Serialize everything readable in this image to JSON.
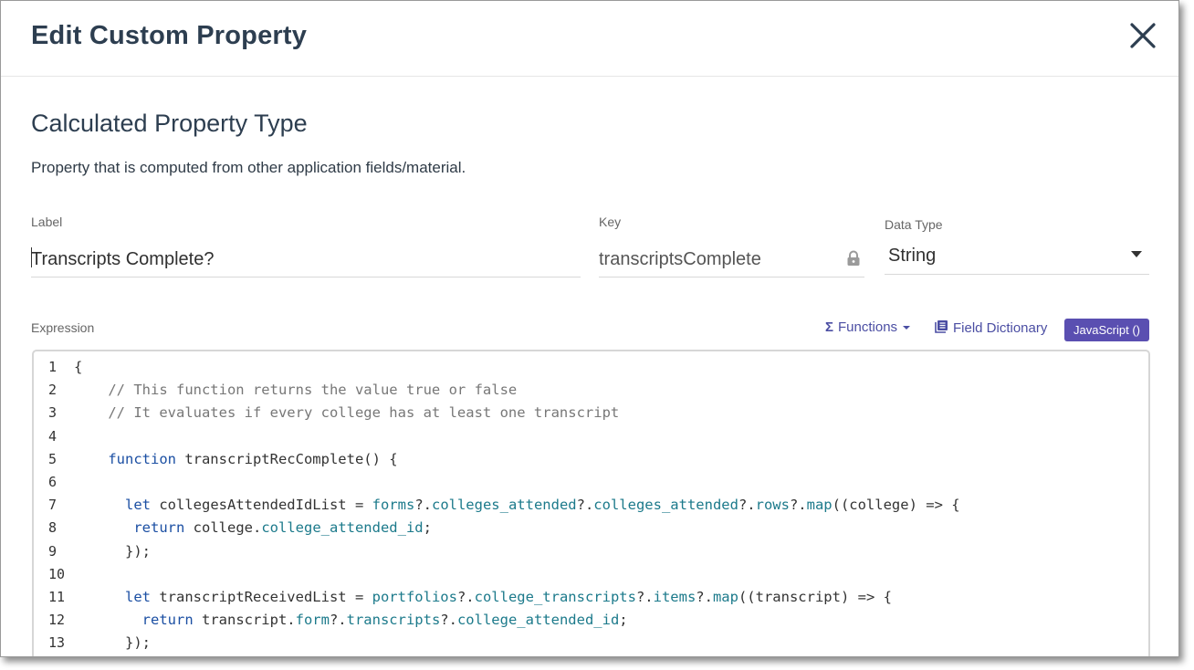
{
  "dialog": {
    "title": "Edit Custom Property",
    "section_title": "Calculated Property Type",
    "description": "Property that is computed from other application fields/material."
  },
  "fields": {
    "label": {
      "label": "Label",
      "value": "Transcripts Complete?"
    },
    "key": {
      "label": "Key",
      "value": "transcriptsComplete"
    },
    "data_type": {
      "label": "Data Type",
      "value": "String"
    }
  },
  "expression": {
    "label": "Expression",
    "functions_label": "Functions",
    "field_dictionary_label": "Field Dictionary",
    "language_button": "JavaScript ()"
  },
  "colors": {
    "accent": "#5a4fb1",
    "title": "#2d3e50",
    "keyword": "#1b4fa3",
    "property": "#1c7a8b",
    "comment": "#777777"
  },
  "code_lines": [
    {
      "n": "1",
      "tokens": [
        [
          "pl",
          "{"
        ]
      ]
    },
    {
      "n": "2",
      "tokens": [
        [
          "cm",
          "    // This function returns the value true or false"
        ]
      ]
    },
    {
      "n": "3",
      "tokens": [
        [
          "cm",
          "    // It evaluates if every college has at least one transcript"
        ]
      ]
    },
    {
      "n": "4",
      "tokens": []
    },
    {
      "n": "5",
      "tokens": [
        [
          "kw",
          "    function"
        ],
        [
          "pl",
          " transcriptRecComplete() {"
        ]
      ]
    },
    {
      "n": "6",
      "tokens": []
    },
    {
      "n": "7",
      "tokens": [
        [
          "kw",
          "      let"
        ],
        [
          "pl",
          " collegesAttendedIdList = "
        ],
        [
          "pr",
          "forms"
        ],
        [
          "pl",
          "?."
        ],
        [
          "pr",
          "colleges_attended"
        ],
        [
          "pl",
          "?."
        ],
        [
          "pr",
          "colleges_attended"
        ],
        [
          "pl",
          "?."
        ],
        [
          "pr",
          "rows"
        ],
        [
          "pl",
          "?."
        ],
        [
          "pr",
          "map"
        ],
        [
          "pl",
          "((college) => {"
        ]
      ]
    },
    {
      "n": "8",
      "tokens": [
        [
          "kw",
          "       return"
        ],
        [
          "pl",
          " college."
        ],
        [
          "pr",
          "college_attended_id"
        ],
        [
          "pl",
          ";"
        ]
      ]
    },
    {
      "n": "9",
      "tokens": [
        [
          "pl",
          "      });"
        ]
      ]
    },
    {
      "n": "10",
      "tokens": []
    },
    {
      "n": "11",
      "tokens": [
        [
          "kw",
          "      let"
        ],
        [
          "pl",
          " transcriptReceivedList = "
        ],
        [
          "pr",
          "portfolios"
        ],
        [
          "pl",
          "?."
        ],
        [
          "pr",
          "college_transcripts"
        ],
        [
          "pl",
          "?."
        ],
        [
          "pr",
          "items"
        ],
        [
          "pl",
          "?."
        ],
        [
          "pr",
          "map"
        ],
        [
          "pl",
          "((transcript) => {"
        ]
      ]
    },
    {
      "n": "12",
      "tokens": [
        [
          "kw",
          "        return"
        ],
        [
          "pl",
          " transcript."
        ],
        [
          "pr",
          "form"
        ],
        [
          "pl",
          "?."
        ],
        [
          "pr",
          "transcripts"
        ],
        [
          "pl",
          "?."
        ],
        [
          "pr",
          "college_attended_id"
        ],
        [
          "pl",
          ";"
        ]
      ]
    },
    {
      "n": "13",
      "tokens": [
        [
          "pl",
          "      });"
        ]
      ]
    }
  ]
}
